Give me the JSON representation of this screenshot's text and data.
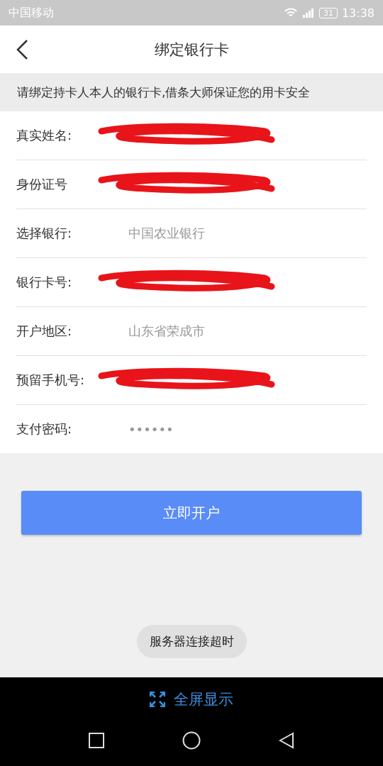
{
  "status_bar": {
    "carrier": "中国移动",
    "battery": "31",
    "time": "13:38"
  },
  "header": {
    "title": "绑定银行卡"
  },
  "notice": "请绑定持卡人本人的银行卡,借条大师保证您的用卡安全",
  "form": [
    {
      "label": "真实姓名:",
      "kind": "redacted"
    },
    {
      "label": "身份证号",
      "kind": "redacted"
    },
    {
      "label": "选择银行:",
      "kind": "text",
      "value": "中国农业银行"
    },
    {
      "label": "银行卡号:",
      "kind": "redacted"
    },
    {
      "label": "开户地区:",
      "kind": "text",
      "value": "山东省荣成市"
    },
    {
      "label": "预留手机号:",
      "kind": "redacted"
    },
    {
      "label": "支付密码:",
      "kind": "text",
      "value": "••••••"
    }
  ],
  "submit_button": "立即开户",
  "toast": "服务器连接超时",
  "fullscreen_bar": {
    "label": "全屏显示"
  }
}
